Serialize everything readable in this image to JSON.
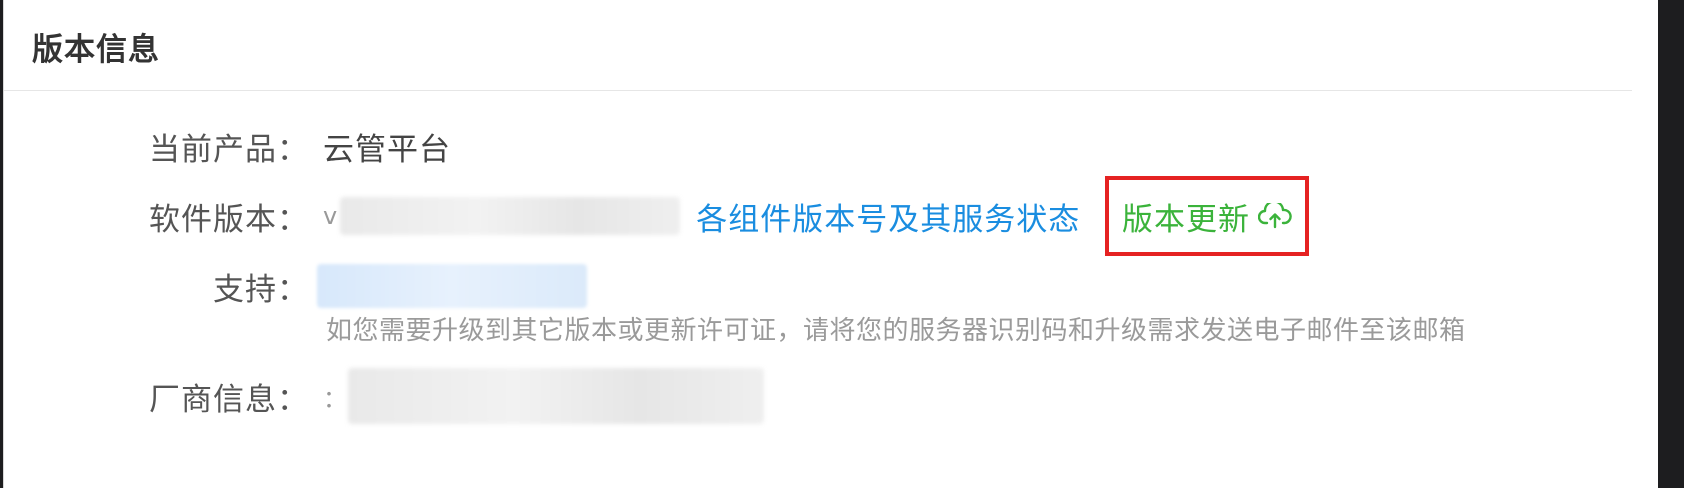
{
  "section": {
    "title": "版本信息"
  },
  "fields": {
    "product": {
      "label": "当前产品：",
      "value": "云管平台"
    },
    "software_version": {
      "label": "软件版本：",
      "value_prefix": "v",
      "components_link": "各组件版本号及其服务状态",
      "update_link": "版本更新"
    },
    "support": {
      "label": "支持：",
      "hint": "如您需要升级到其它版本或更新许可证，请将您的服务器识别码和升级需求发送电子邮件至该邮箱"
    },
    "vendor": {
      "label": "厂商信息：",
      "value_prefix": "："
    }
  },
  "icons": {
    "update": "cloud-upload-icon"
  },
  "colors": {
    "link_blue": "#1a8de0",
    "update_green": "#3bb33b",
    "highlight_red": "#e52222"
  }
}
